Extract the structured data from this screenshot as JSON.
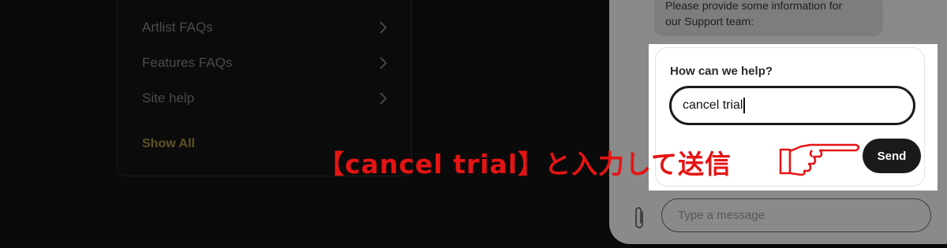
{
  "faq": {
    "items": [
      {
        "label": "Artlist FAQs",
        "icon": "chevron-right-icon"
      },
      {
        "label": "Features FAQs",
        "icon": "chevron-right-icon"
      },
      {
        "label": "Site help",
        "icon": "chevron-right-icon"
      }
    ],
    "show_all": "Show All"
  },
  "chat": {
    "bot_message_line1": "Please provide some information for",
    "bot_message_line2": "our Support team:",
    "form": {
      "label": "How can we help?",
      "input_value": "cancel trial",
      "send_label": "Send"
    },
    "message_input": {
      "placeholder": "Type a message"
    },
    "attach_icon": "paperclip-icon"
  },
  "annotation": {
    "text": "【cancel trial】と入力して送信",
    "color": "#e51414",
    "icon": "pointing-hand-icon"
  },
  "colors": {
    "background": "#0a0a0a",
    "widget_overlay": "#8a8a8a",
    "send_button": "#1a1a1a"
  }
}
